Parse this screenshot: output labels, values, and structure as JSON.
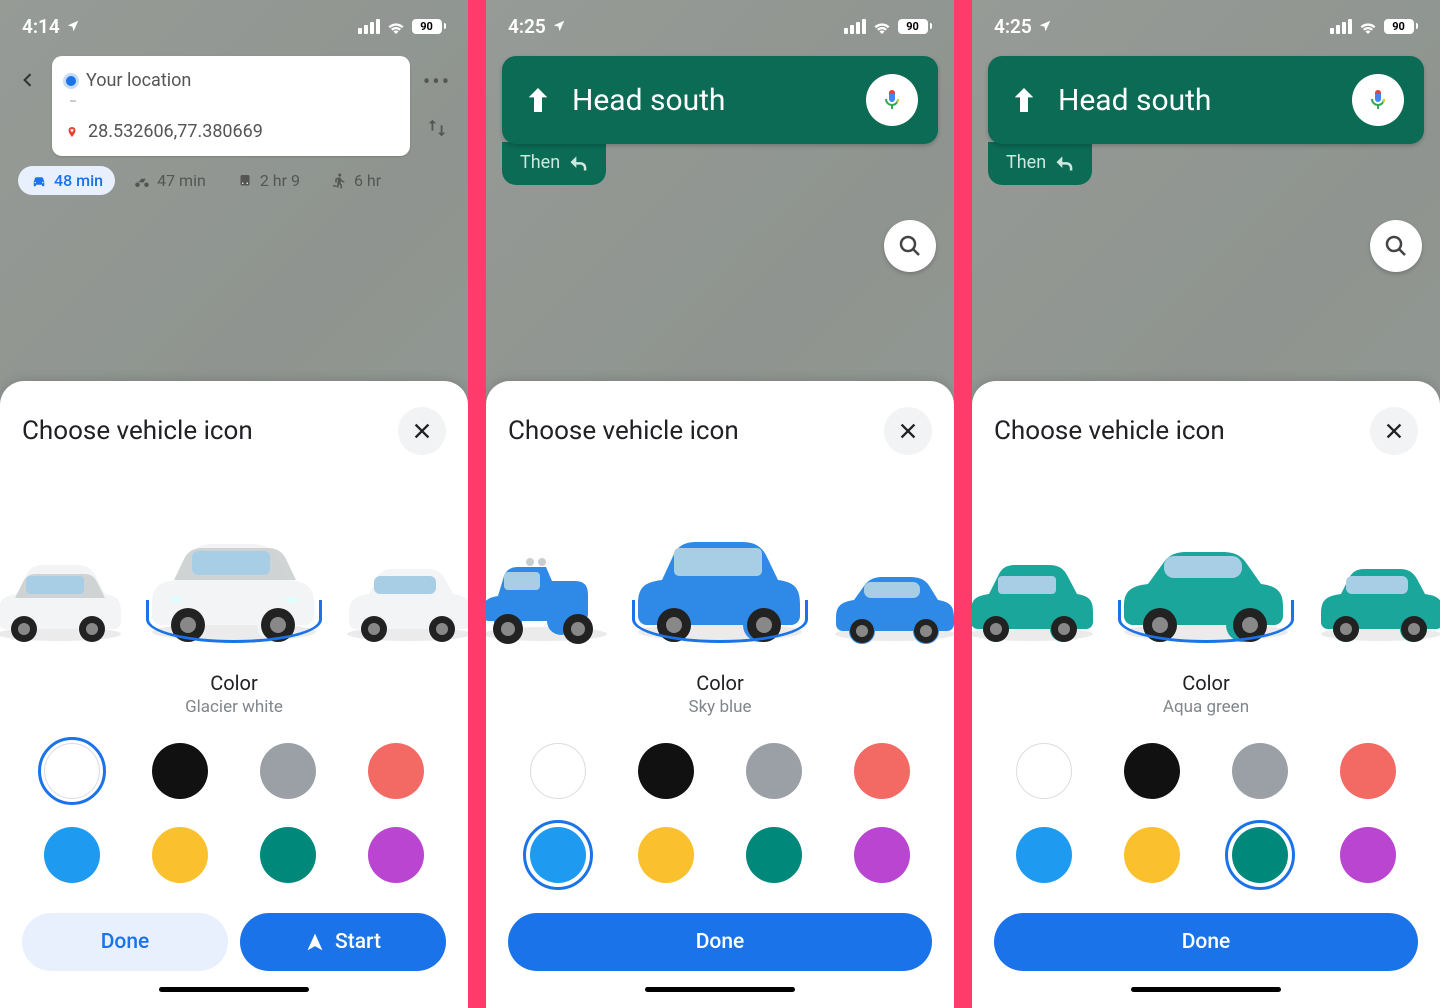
{
  "status": {
    "battery": "90"
  },
  "screens": [
    {
      "time": "4:14",
      "header_type": "route",
      "route": {
        "from": "Your location",
        "to": "28.532606,77.380669"
      },
      "travel": [
        {
          "icon": "car",
          "label": "48 min",
          "selected": true
        },
        {
          "icon": "moto",
          "label": "47 min",
          "selected": false
        },
        {
          "icon": "transit",
          "label": "2 hr 9",
          "selected": false
        },
        {
          "icon": "walk",
          "label": "6 hr",
          "selected": false
        }
      ],
      "sheet": {
        "title": "Choose vehicle icon",
        "color_label": "Color",
        "selected_color_name": "Glacier white",
        "selected_color_index": 0,
        "buttons": [
          {
            "kind": "secondary",
            "label": "Done"
          },
          {
            "kind": "primary",
            "label": "Start",
            "icon": true
          }
        ],
        "vehicle_color": "#f3f4f5",
        "vehicle_shade": "#c9ccce"
      }
    },
    {
      "time": "4:25",
      "header_type": "nav",
      "nav": {
        "direction": "Head south",
        "then": "Then"
      },
      "sheet": {
        "title": "Choose vehicle icon",
        "color_label": "Color",
        "selected_color_name": "Sky blue",
        "selected_color_index": 4,
        "buttons": [
          {
            "kind": "primary",
            "label": "Done"
          }
        ],
        "vehicle_color": "#2e8ae6",
        "vehicle_shade": "#1557a0"
      }
    },
    {
      "time": "4:25",
      "header_type": "nav",
      "nav": {
        "direction": "Head south",
        "then": "Then"
      },
      "sheet": {
        "title": "Choose vehicle icon",
        "color_label": "Color",
        "selected_color_name": "Aqua green",
        "selected_color_index": 6,
        "buttons": [
          {
            "kind": "primary",
            "label": "Done"
          }
        ],
        "vehicle_color": "#1aa69a",
        "vehicle_shade": "#0d6b63"
      }
    }
  ],
  "colors": [
    {
      "name": "Glacier white",
      "hex": "#ffffff",
      "white": true
    },
    {
      "name": "Black",
      "hex": "#111111"
    },
    {
      "name": "Grey",
      "hex": "#9aa0a6"
    },
    {
      "name": "Coral",
      "hex": "#f26a63"
    },
    {
      "name": "Sky blue",
      "hex": "#1e9bf0"
    },
    {
      "name": "Yellow",
      "hex": "#fbc02d"
    },
    {
      "name": "Aqua green",
      "hex": "#00897b"
    },
    {
      "name": "Purple",
      "hex": "#ba45d1"
    }
  ]
}
